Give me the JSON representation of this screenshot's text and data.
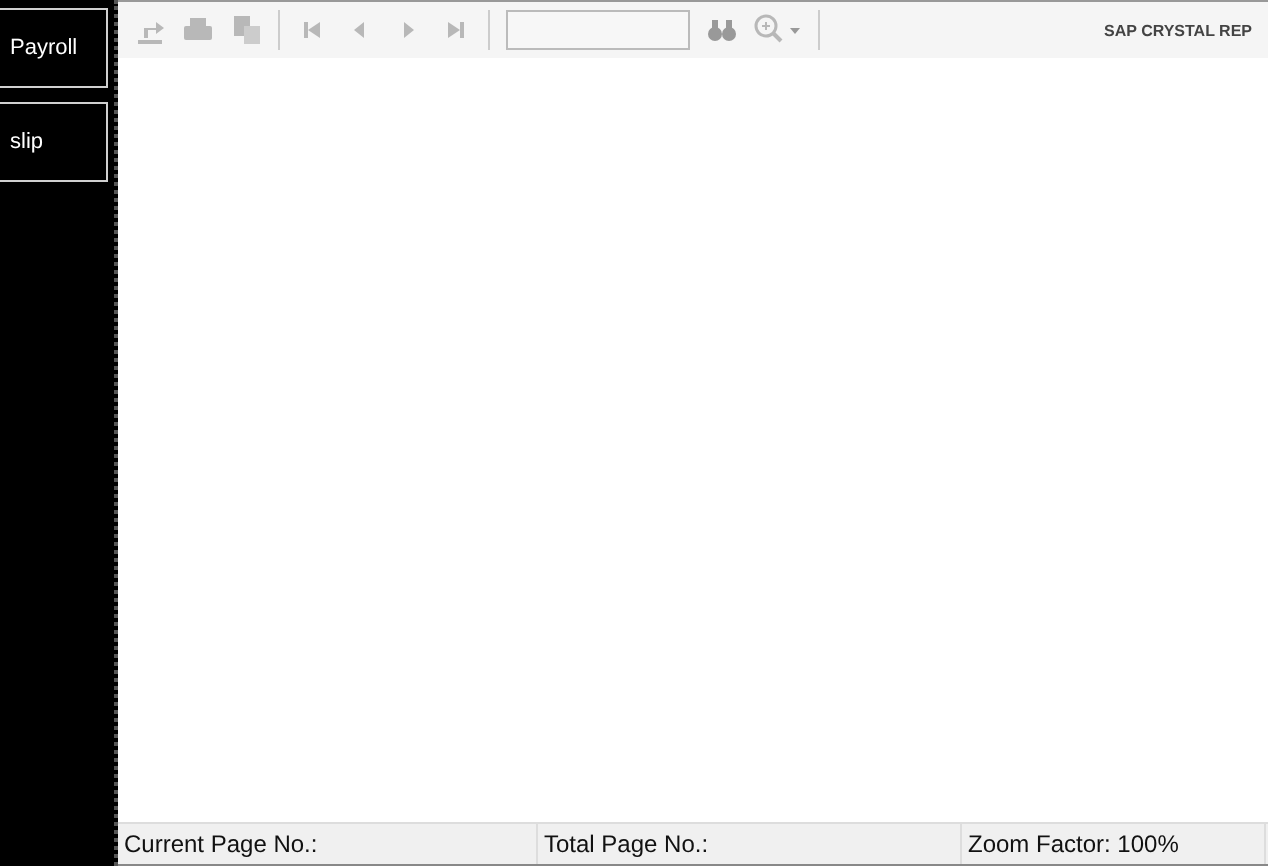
{
  "sidebar": {
    "buttons": [
      "Payroll",
      "slip"
    ]
  },
  "toolbar": {
    "brand": "SAP CRYSTAL REP"
  },
  "status_bar": [
    "Current Page No.:",
    "Total Page No.:",
    "Zoom Factor: 100%"
  ]
}
